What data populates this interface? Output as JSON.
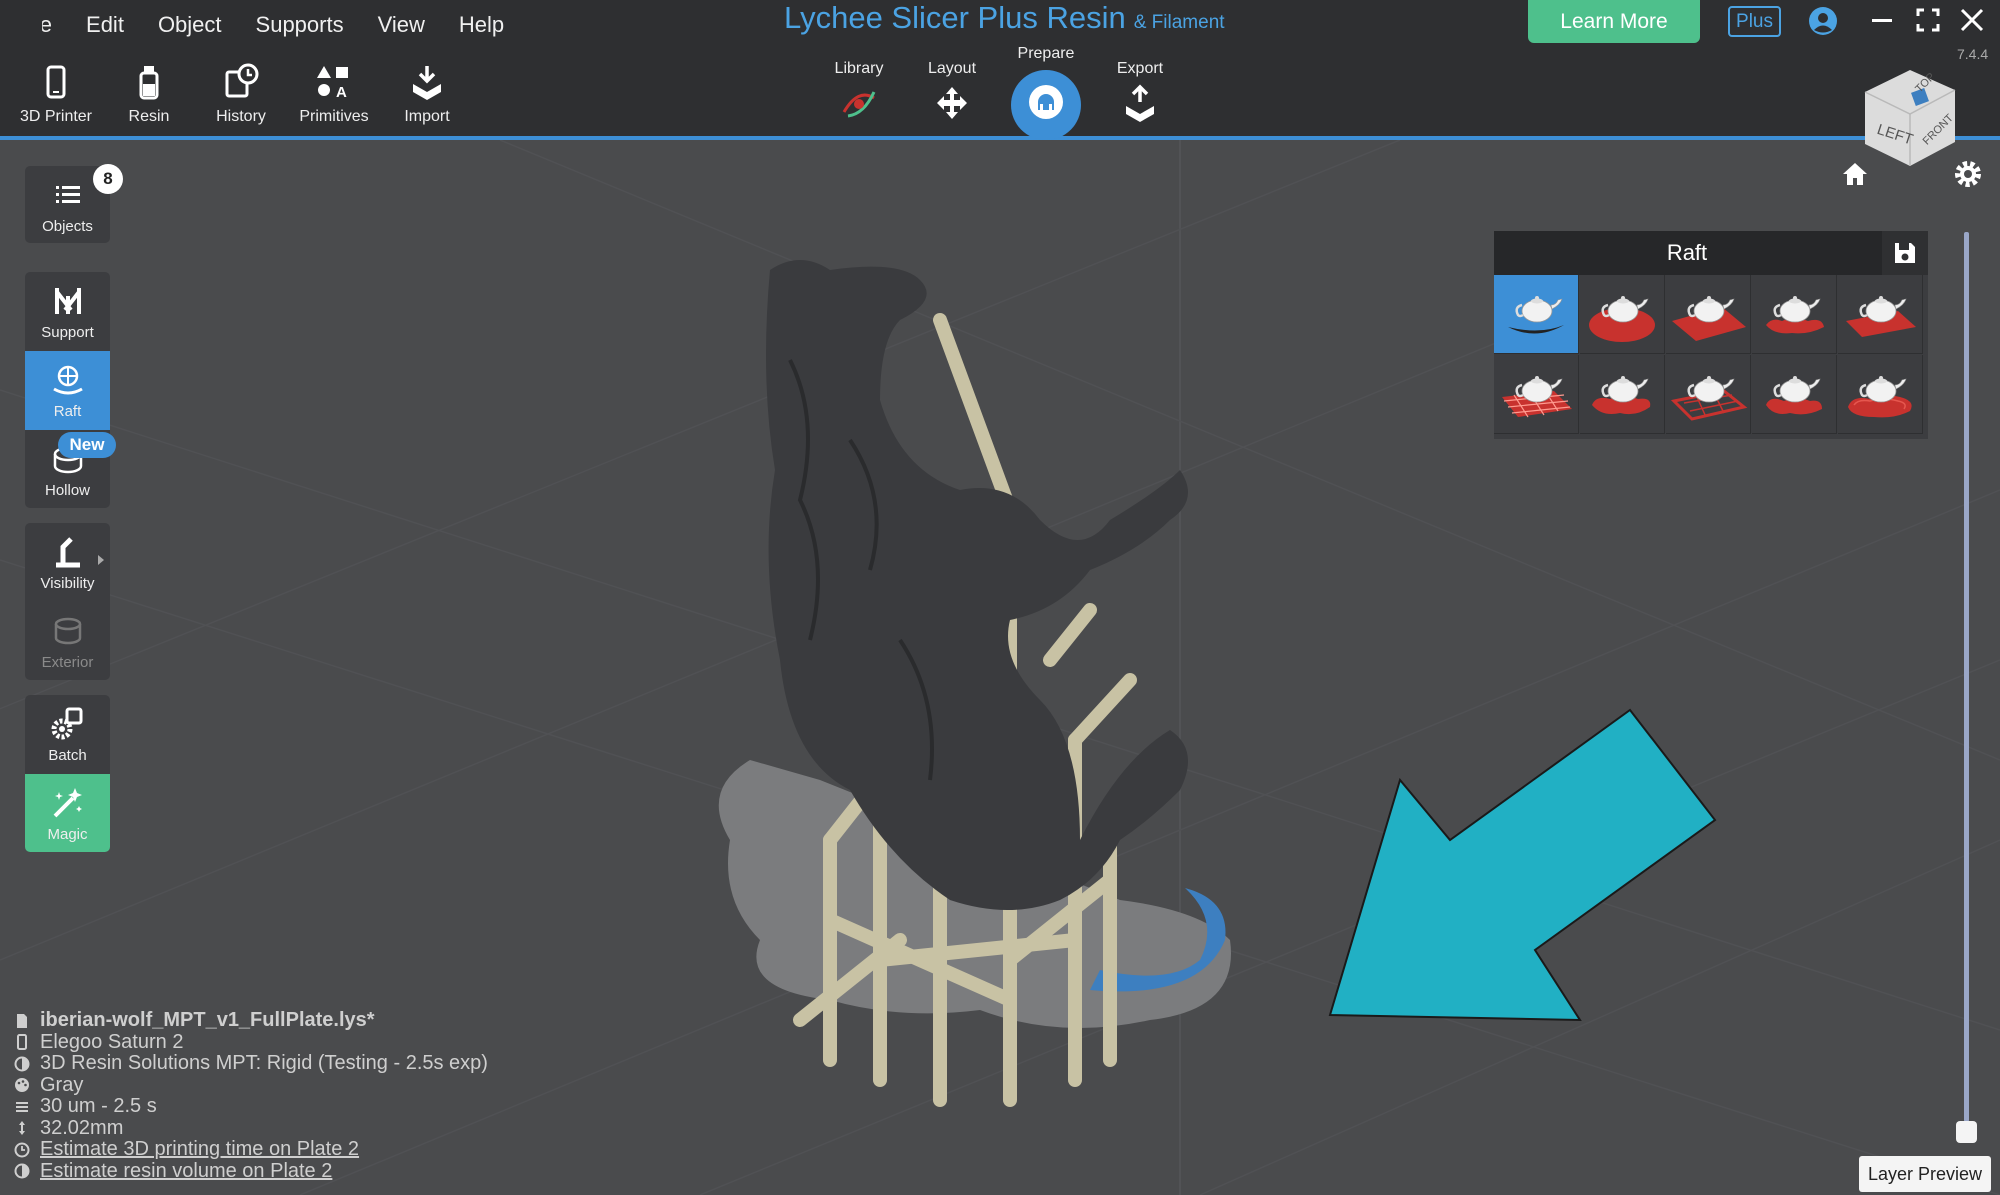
{
  "menu": [
    "ile",
    "Edit",
    "Object",
    "Supports",
    "View",
    "Help"
  ],
  "app_title": "Lychee Slicer Plus Resin",
  "app_title_sub": "& Filament",
  "learn_more": "Learn More",
  "plus_label": "Plus",
  "version": "7.4.4",
  "toolbar": [
    {
      "label": "3D Printer",
      "icon": "printer-phone-icon"
    },
    {
      "label": "Resin",
      "icon": "resin-bottle-icon"
    },
    {
      "label": "History",
      "icon": "history-icon"
    },
    {
      "label": "Primitives",
      "icon": "primitives-icon"
    },
    {
      "label": "Import",
      "icon": "import-icon"
    }
  ],
  "stages": [
    {
      "label": "Library",
      "icon": "library-icon"
    },
    {
      "label": "Layout",
      "icon": "move-arrows-icon"
    },
    {
      "label": "Prepare",
      "icon": "prepare-icon",
      "active": true
    },
    {
      "label": "Export",
      "icon": "export-icon"
    }
  ],
  "sidebar": {
    "objects": {
      "label": "Objects",
      "count": "8"
    },
    "support": {
      "label": "Support"
    },
    "raft": {
      "label": "Raft"
    },
    "hollow": {
      "label": "Hollow",
      "badge": "New"
    },
    "visibility": {
      "label": "Visibility"
    },
    "exterior": {
      "label": "Exterior"
    },
    "batch": {
      "label": "Batch"
    },
    "magic": {
      "label": "Magic"
    }
  },
  "raft_panel": {
    "title": "Raft",
    "selected_index": 0,
    "options": [
      "raft-none",
      "raft-round",
      "raft-square",
      "raft-outline",
      "raft-flat",
      "raft-grid",
      "raft-blob",
      "raft-lattice",
      "raft-splash",
      "raft-contour"
    ]
  },
  "layer_preview": "Layer Preview",
  "info": {
    "file": "iberian-wolf_MPT_v1_FullPlate.lys*",
    "printer": "Elegoo Saturn 2",
    "resin": "3D Resin Solutions MPT: Rigid (Testing - 2.5s exp)",
    "color": "Gray",
    "layer": "30 um - 2.5 s",
    "height": "32.02mm",
    "estimate_time": "Estimate 3D printing time on Plate 2",
    "estimate_resin": "Estimate resin volume on Plate 2"
  },
  "colors": {
    "accent": "#3d8fd6",
    "learn_more": "#4ec08c",
    "magic": "#4ec08c",
    "raft_red": "#c8322e",
    "arrow": "#21b0c4",
    "support": "#c8c2a4"
  }
}
